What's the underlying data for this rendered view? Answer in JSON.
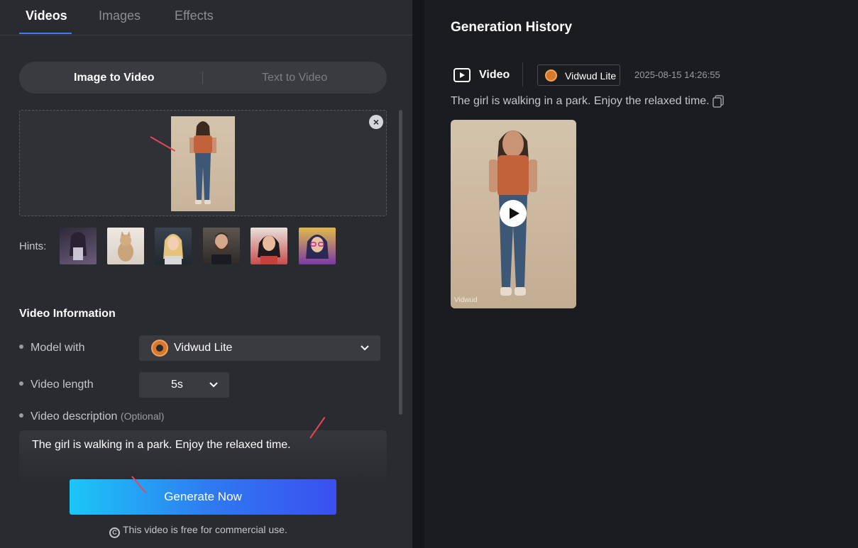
{
  "tabs": [
    "Videos",
    "Images",
    "Effects"
  ],
  "mode": {
    "active": "Image to Video",
    "inactive": "Text to Video"
  },
  "hints_label": "Hints:",
  "hint_icons": [
    "anime-girl-thumbnail",
    "cat-thumbnail",
    "blonde-woman-thumbnail",
    "bearded-man-thumbnail",
    "cartoon-woman-thumbnail",
    "anime-girl-glasses-thumbnail"
  ],
  "video_info": {
    "title": "Video Information",
    "model_label": "Model with",
    "model_value": "Vidwud Lite",
    "length_label": "Video length",
    "length_value": "5s",
    "desc_label": "Video description",
    "desc_optional": "(Optional)",
    "desc_value": "The girl is walking in a park. Enjoy the relaxed time."
  },
  "generate_label": "Generate Now",
  "free_note": "This video is free for commercial use.",
  "history": {
    "title": "Generation History",
    "type_label": "Video",
    "model": "Vidwud Lite",
    "date": "2025-08-15 14:26:55",
    "prompt": "The girl is walking in a park. Enjoy the relaxed time.",
    "watermark": "Vidwud"
  },
  "colors": {
    "accent": "#3d7cf5",
    "annotation": "#e8445a",
    "brand": "#d9772b"
  }
}
